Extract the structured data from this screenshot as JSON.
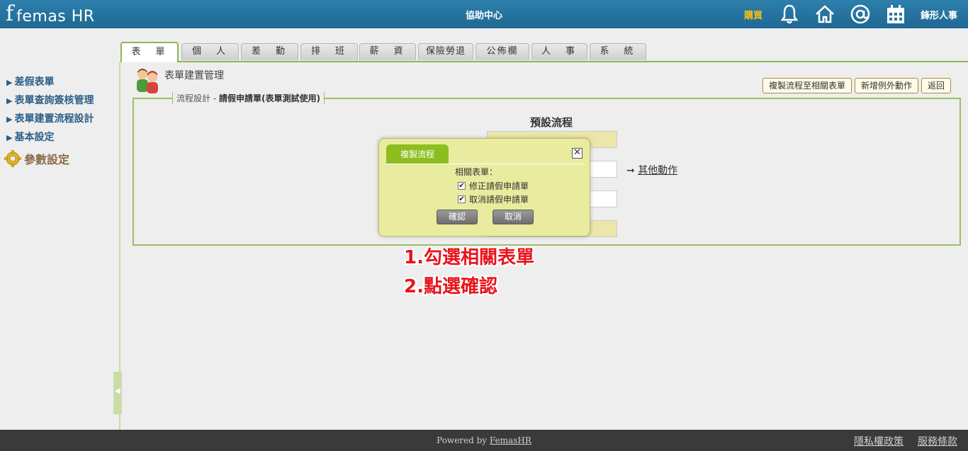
{
  "header": {
    "logo_mark": "f",
    "logo_text": "femas HR",
    "center_title": "協助中心",
    "buy": "購買",
    "company": "鋒形人事",
    "icons": [
      "bell-icon",
      "home-icon",
      "at-icon",
      "calendar-icon"
    ]
  },
  "tabs": [
    {
      "label": "表　單"
    },
    {
      "label": "個　人"
    },
    {
      "label": "差　勤"
    },
    {
      "label": "排　班"
    },
    {
      "label": "薪　資"
    },
    {
      "label": "保險勞退"
    },
    {
      "label": "公佈欄"
    },
    {
      "label": "人　事"
    },
    {
      "label": "系　統"
    }
  ],
  "sidebar": {
    "items": [
      {
        "label": "差假表單"
      },
      {
        "label": "表單查詢簽核管理"
      },
      {
        "label": "表單建置流程設計"
      },
      {
        "label": "基本設定"
      }
    ],
    "param": "參數設定"
  },
  "main": {
    "page_title": "表單建置管理",
    "buttons": {
      "copy_flow": "複製流程至相關表單",
      "add_exception": "新增例外動作",
      "back": "返回"
    },
    "legend_prefix": "流程設計 - ",
    "legend_bold": "請假申請單(表單測試使用)",
    "flow_title": "預設流程",
    "other_action": "其他動作"
  },
  "modal": {
    "title": "複製流程",
    "label": "相關表單：",
    "options": [
      {
        "label": "修正請假申請單",
        "checked": true
      },
      {
        "label": "取消請假申請單",
        "checked": true
      }
    ],
    "confirm": "確認",
    "cancel": "取消"
  },
  "annotation": {
    "line1": "1.勾選相關表單",
    "line2": "2.點選確認"
  },
  "footer": {
    "powered_prefix": "Powered by ",
    "powered_link": "FemasHR",
    "privacy": "隱私權政策",
    "terms": "服務條款"
  },
  "colors": {
    "header_blue": "#2878a6",
    "tab_green": "#8db653",
    "modal_bg": "#e9ec9f",
    "modal_tab": "#8dbe1f",
    "annotation_red": "#e8141c",
    "buy_gold": "#f3c11a"
  }
}
